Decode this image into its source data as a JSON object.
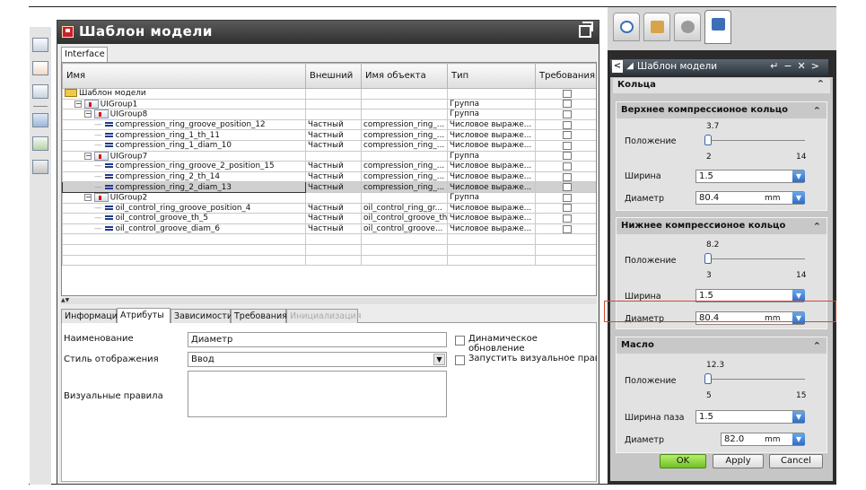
{
  "dialog": {
    "title": "Шаблон модели",
    "tab": "Interface"
  },
  "tree": {
    "columns": [
      "Имя",
      "Внешний",
      "Имя объекта",
      "Тип",
      "Требования"
    ],
    "rows": [
      {
        "name": "Шаблон модели",
        "external": "",
        "object": "",
        "type": ""
      },
      {
        "name": "UIGroup1",
        "external": "",
        "object": "",
        "type": "Группа"
      },
      {
        "name": "UIGroup8",
        "external": "",
        "object": "",
        "type": "Группа"
      },
      {
        "name": "compression_ring_groove_position_12",
        "external": "Частный",
        "object": "compression_ring_...",
        "type": "Числовое выраже..."
      },
      {
        "name": "compression_ring_1_th_11",
        "external": "Частный",
        "object": "compression_ring_...",
        "type": "Числовое выраже..."
      },
      {
        "name": "compression_ring_1_diam_10",
        "external": "Частный",
        "object": "compression_ring_...",
        "type": "Числовое выраже..."
      },
      {
        "name": "UIGroup7",
        "external": "",
        "object": "",
        "type": "Группа"
      },
      {
        "name": "compression_ring_groove_2_position_15",
        "external": "Частный",
        "object": "compression_ring_...",
        "type": "Числовое выраже..."
      },
      {
        "name": "compression_ring_2_th_14",
        "external": "Частный",
        "object": "compression_ring_...",
        "type": "Числовое выраже..."
      },
      {
        "name": "compression_ring_2_diam_13",
        "external": "Частный",
        "object": "compression_ring_...",
        "type": "Числовое выраже..."
      },
      {
        "name": "UIGroup2",
        "external": "",
        "object": "",
        "type": "Группа"
      },
      {
        "name": "oil_control_ring_groove_position_4",
        "external": "Частный",
        "object": "oil_control_ring_gr...",
        "type": "Числовое выраже..."
      },
      {
        "name": "oil_control_groove_th_5",
        "external": "Частный",
        "object": "oil_control_groove_th",
        "type": "Числовое выраже..."
      },
      {
        "name": "oil_control_groove_diam_6",
        "external": "Частный",
        "object": "oil_control_groove...",
        "type": "Числовое выраже..."
      }
    ]
  },
  "subtabs": [
    "Информация",
    "Атрибуты",
    "Зависимости",
    "Требования",
    "Инициализация"
  ],
  "attributes": {
    "name_label": "Наименование",
    "name_value": "Диаметр",
    "style_label": "Стиль отображения",
    "style_value": "Ввод",
    "rules_label": "Визуальные правила",
    "dynamic_label": "Динамическое обновление",
    "run_rule_label": "Запустить визуальное правило п"
  },
  "panel": {
    "title": "Шаблон модели",
    "section": "Кольца",
    "upper": {
      "title": "Верхнее компрессионое кольцо",
      "position_label": "Положение",
      "pos_value": "3.7",
      "pos_min": "2",
      "pos_max": "14",
      "width_label": "Ширина",
      "width_value": "1.5",
      "diam_label": "Диаметр",
      "diam_value": "80.4",
      "diam_unit": "mm"
    },
    "lower": {
      "title": "Нижнее компрессионое кольцо",
      "position_label": "Положение",
      "pos_value": "8.2",
      "pos_min": "3",
      "pos_max": "14",
      "width_label": "Ширина",
      "width_value": "1.5",
      "diam_label": "Диаметр",
      "diam_value": "80.4",
      "diam_unit": "mm"
    },
    "oil": {
      "title": "Масло",
      "position_label": "Положение",
      "pos_value": "12.3",
      "pos_min": "5",
      "pos_max": "15",
      "width_label": "Ширина паза",
      "width_value": "1.5",
      "diam_label": "Диаметр",
      "diam_value": "82.0",
      "diam_unit": "mm"
    },
    "buttons": {
      "ok": "OK",
      "apply": "Apply",
      "cancel": "Cancel"
    }
  }
}
